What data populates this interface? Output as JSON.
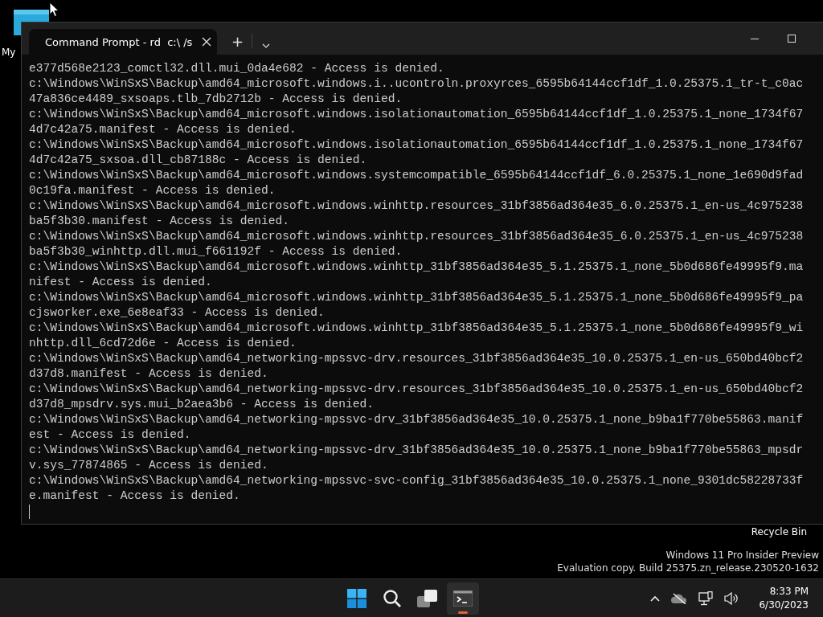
{
  "desktop": {
    "icons": [
      {
        "kind": "folder",
        "label": "My"
      },
      {
        "kind": "bin",
        "label": "Recycle Bin"
      }
    ],
    "watermark": [
      "Windows 11 Pro Insider Preview",
      "Evaluation copy. Build 25375.zn_release.230520-1632"
    ]
  },
  "window": {
    "tabs": [
      {
        "title": "Command Prompt - rd  c:\\ /s",
        "selected": true
      }
    ],
    "new_tab": "+",
    "lines": [
      "e377d568e2123_comctl32.dll.mui_0da4e682 - Access is denied.",
      "c:\\Windows\\WinSxS\\Backup\\amd64_microsoft.windows.i..ucontroln.proxyrces_6595b64144ccf1df_1.0.25375.1_tr-t_c0ac",
      "47a836ce4489_sxsoaps.tlb_7db2712b - Access is denied.",
      "c:\\Windows\\WinSxS\\Backup\\amd64_microsoft.windows.isolationautomation_6595b64144ccf1df_1.0.25375.1_none_1734f67",
      "4d7c42a75.manifest - Access is denied.",
      "c:\\Windows\\WinSxS\\Backup\\amd64_microsoft.windows.isolationautomation_6595b64144ccf1df_1.0.25375.1_none_1734f67",
      "4d7c42a75_sxsoa.dll_cb87188c - Access is denied.",
      "c:\\Windows\\WinSxS\\Backup\\amd64_microsoft.windows.systemcompatible_6595b64144ccf1df_6.0.25375.1_none_1e690d9fad",
      "0c19fa.manifest - Access is denied.",
      "c:\\Windows\\WinSxS\\Backup\\amd64_microsoft.windows.winhttp.resources_31bf3856ad364e35_6.0.25375.1_en-us_4c975238",
      "ba5f3b30.manifest - Access is denied.",
      "c:\\Windows\\WinSxS\\Backup\\amd64_microsoft.windows.winhttp.resources_31bf3856ad364e35_6.0.25375.1_en-us_4c975238",
      "ba5f3b30_winhttp.dll.mui_f661192f - Access is denied.",
      "c:\\Windows\\WinSxS\\Backup\\amd64_microsoft.windows.winhttp_31bf3856ad364e35_5.1.25375.1_none_5b0d686fe49995f9.ma",
      "nifest - Access is denied.",
      "c:\\Windows\\WinSxS\\Backup\\amd64_microsoft.windows.winhttp_31bf3856ad364e35_5.1.25375.1_none_5b0d686fe49995f9_pa",
      "cjsworker.exe_6e8eaf33 - Access is denied.",
      "c:\\Windows\\WinSxS\\Backup\\amd64_microsoft.windows.winhttp_31bf3856ad364e35_5.1.25375.1_none_5b0d686fe49995f9_wi",
      "nhttp.dll_6cd72d6e - Access is denied.",
      "c:\\Windows\\WinSxS\\Backup\\amd64_networking-mpssvc-drv.resources_31bf3856ad364e35_10.0.25375.1_en-us_650bd40bcf2",
      "d37d8.manifest - Access is denied.",
      "c:\\Windows\\WinSxS\\Backup\\amd64_networking-mpssvc-drv.resources_31bf3856ad364e35_10.0.25375.1_en-us_650bd40bcf2",
      "d37d8_mpsdrv.sys.mui_b2aea3b6 - Access is denied.",
      "c:\\Windows\\WinSxS\\Backup\\amd64_networking-mpssvc-drv_31bf3856ad364e35_10.0.25375.1_none_b9ba1f770be55863.manif",
      "est - Access is denied.",
      "c:\\Windows\\WinSxS\\Backup\\amd64_networking-mpssvc-drv_31bf3856ad364e35_10.0.25375.1_none_b9ba1f770be55863_mpsdr",
      "v.sys_77874865 - Access is denied.",
      "c:\\Windows\\WinSxS\\Backup\\amd64_networking-mpssvc-svc-config_31bf3856ad364e35_10.0.25375.1_none_9301dc58228733f",
      "e.manifest - Access is denied."
    ]
  },
  "taskbar": {
    "apps": [
      {
        "kind": "start",
        "active": false
      },
      {
        "kind": "search",
        "active": false
      },
      {
        "kind": "taskview",
        "active": false
      },
      {
        "kind": "terminal",
        "active": true
      }
    ],
    "time": "8:33 PM",
    "date": "6/30/2023"
  }
}
